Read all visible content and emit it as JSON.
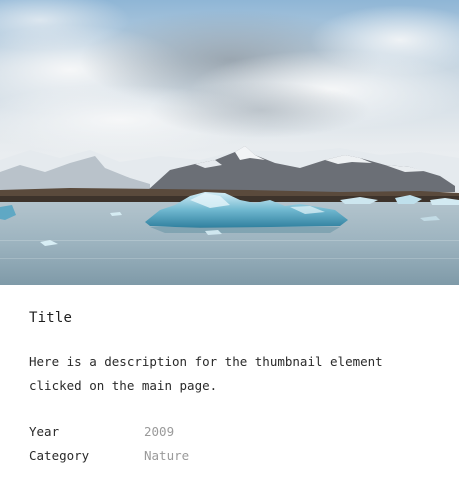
{
  "detail": {
    "title": "Title",
    "description": "Here is a description for the thumbnail element clicked on the main page.",
    "meta": [
      {
        "key": "Year",
        "value": "2009"
      },
      {
        "key": "Category",
        "value": "Nature"
      }
    ]
  }
}
